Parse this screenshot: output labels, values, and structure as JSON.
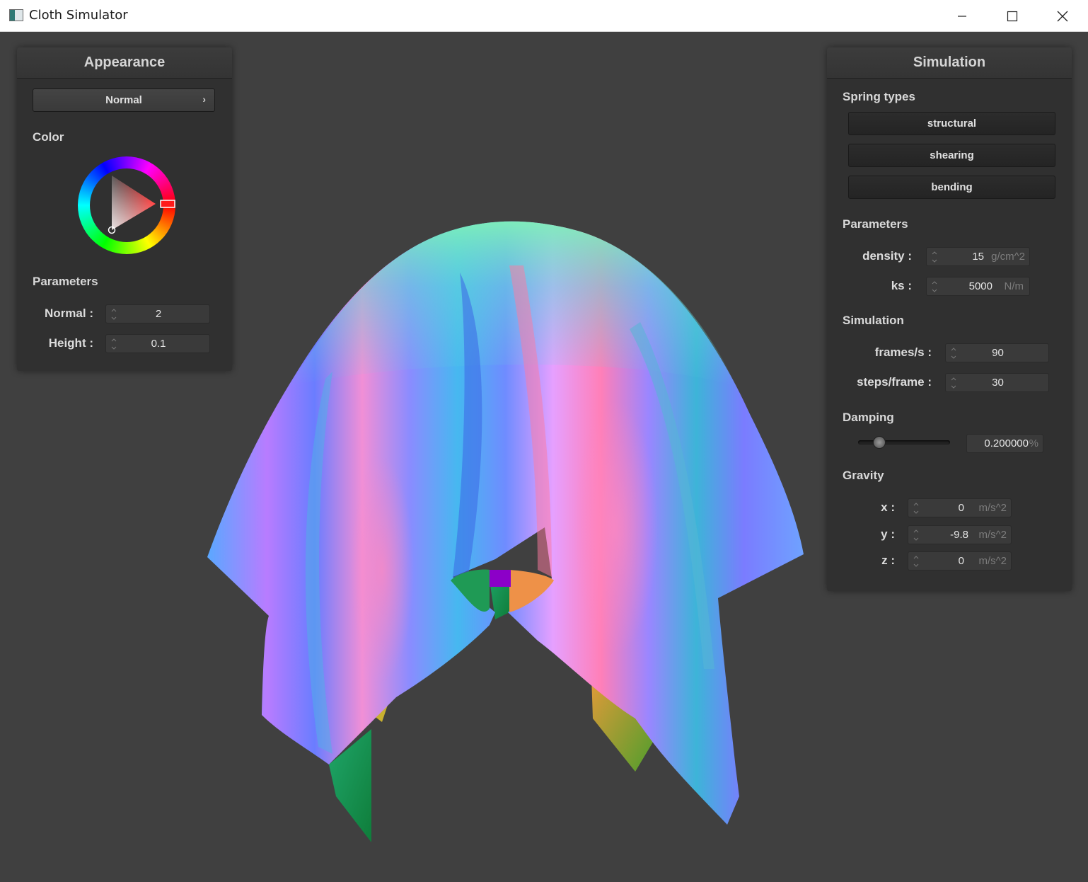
{
  "window": {
    "title": "Cloth Simulator"
  },
  "appearance": {
    "header": "Appearance",
    "shader_select": "Normal",
    "color_label": "Color",
    "parameters_label": "Parameters",
    "normal_label": "Normal :",
    "normal_value": "2",
    "height_label": "Height :",
    "height_value": "0.1"
  },
  "simulation": {
    "header": "Simulation",
    "spring_types_label": "Spring types",
    "structural": "structural",
    "shearing": "shearing",
    "bending": "bending",
    "parameters_label": "Parameters",
    "density_label": "density :",
    "density_value": "15",
    "density_unit": "g/cm^2",
    "ks_label": "ks :",
    "ks_value": "5000",
    "ks_unit": "N/m",
    "simulation_label": "Simulation",
    "fps_label": "frames/s :",
    "fps_value": "90",
    "steps_label": "steps/frame :",
    "steps_value": "30",
    "damping_label": "Damping",
    "damping_value": "0.200000",
    "damping_unit": "%",
    "damping_fraction": 0.2,
    "gravity_label": "Gravity",
    "gx_label": "x :",
    "gx_value": "0",
    "gy_label": "y :",
    "gy_value": "-9.8",
    "gz_label": "z :",
    "gz_value": "0",
    "g_unit": "m/s^2"
  },
  "colors": {
    "background": "#404040",
    "panel": "#303030",
    "selected_color": "#ff1a1a"
  }
}
